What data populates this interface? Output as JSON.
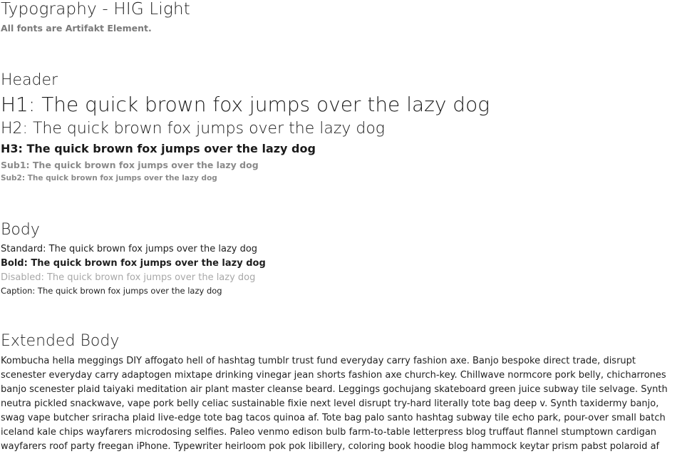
{
  "page": {
    "title": "Typography - HIG Light",
    "subtitle": "All fonts are Artifakt Element."
  },
  "header_section": {
    "label": "Header",
    "h1": "H1: The quick brown fox jumps over the lazy dog",
    "h2": "H2: The quick brown fox jumps over the lazy dog",
    "h3": "H3: The quick brown fox jumps over the lazy dog",
    "sub1": "Sub1: The quick brown fox jumps over the lazy dog",
    "sub2": "Sub2: The quick brown fox jumps over the lazy dog"
  },
  "body_section": {
    "label": "Body",
    "standard": "Standard: The quick brown fox jumps over the lazy dog",
    "bold": "Bold: The quick brown fox jumps over the lazy dog",
    "disabled": "Disabled: The quick brown fox jumps over the lazy dog",
    "caption": "Caption: The quick brown fox jumps over the lazy dog"
  },
  "extended_section": {
    "label": "Extended Body",
    "lines": [
      "Kombucha hella meggings DIY affogato hell of hashtag tumblr trust fund everyday carry fashion axe. Banjo bespoke direct trade, disrupt",
      "scenester everyday carry adaptogen mixtape drinking vinegar jean shorts fashion axe church-key. Chillwave normcore pork belly, chicharrones",
      "banjo scenester plaid taiyaki meditation air plant master cleanse beard. Leggings gochujang skateboard green juice subway tile selvage. Synth",
      "neutra pickled snackwave, vape pork belly celiac sustainable fixie next level disrupt try-hard literally tote bag deep v. Synth taxidermy banjo,",
      "swag vape butcher sriracha plaid live-edge tote bag tacos quinoa af. Tote bag palo santo hashtag subway tile echo park, pour-over small batch",
      "iceland kale chips wayfarers microdosing selfies. Paleo venmo edison bulb farm-to-table letterpress blog truffaut flannel stumptown cardigan",
      "wayfarers roof party freegan iPhone. Typewriter heirloom pok pok libillery, coloring book hoodie blog hammock keytar prism pabst polaroid af"
    ]
  }
}
